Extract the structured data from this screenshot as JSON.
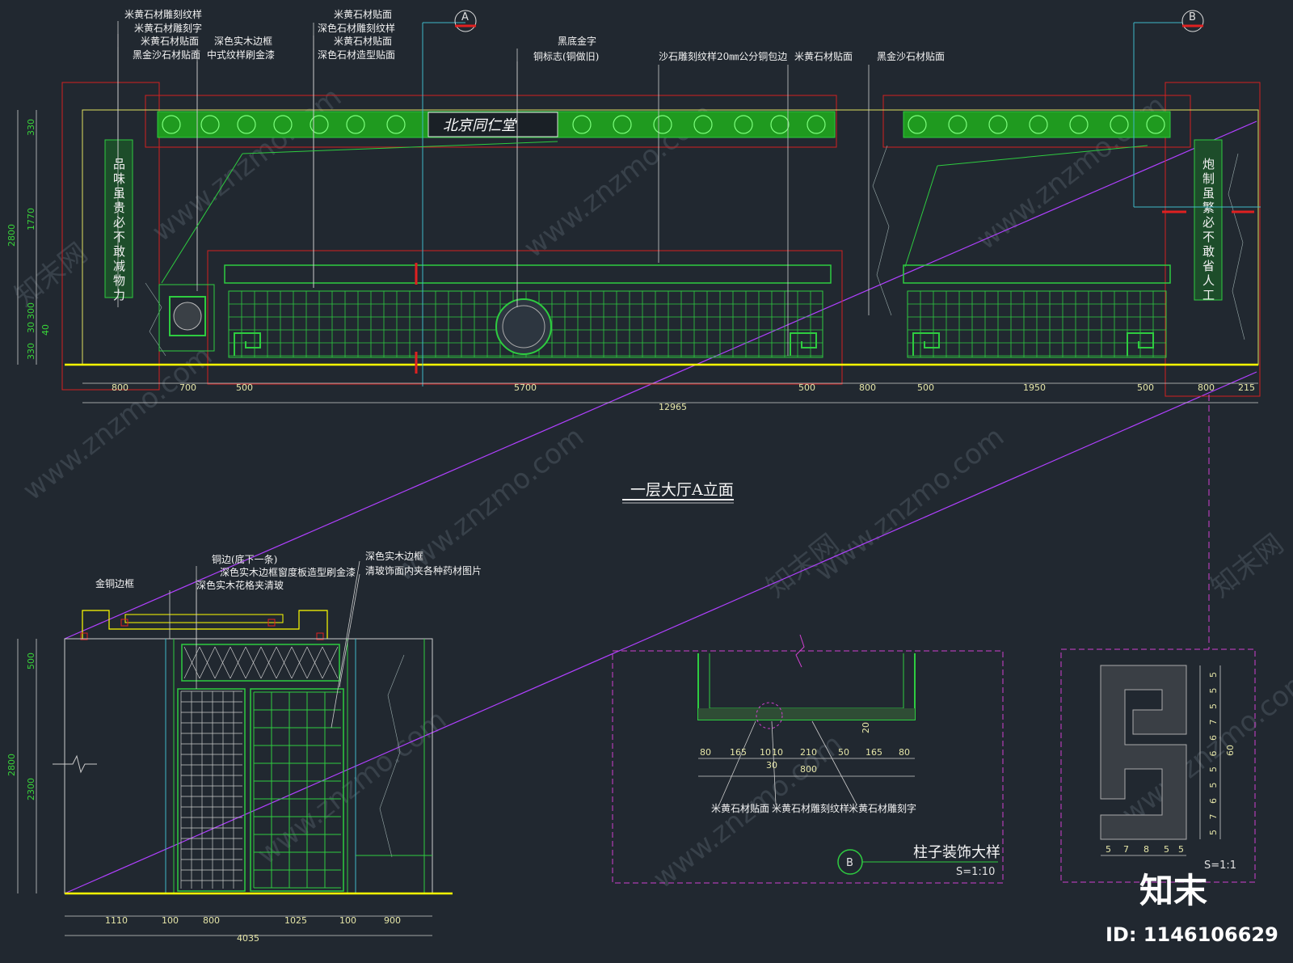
{
  "colors": {
    "background": "#212830",
    "line": "#2ecc40",
    "red": "#d42020",
    "yellow": "#ffff00",
    "magenta": "#c040ff",
    "cyan": "#3fb8c8"
  },
  "elevation_a": {
    "title": "一层大厅A立面",
    "sign_text": "北京同仁堂",
    "left_couplet": "品味虽贵必不敢减物力",
    "right_couplet": "炮制虽繁必不敢省人工",
    "section_markers": [
      "A",
      "B"
    ],
    "labels": {
      "l1": "米黄石材雕刻纹样",
      "l2": "米黄石材雕刻字",
      "l3": "米黄石材贴面",
      "l4": "黑金沙石材贴面",
      "l5": "深色实木边框",
      "l6": "中式纹样刷金漆",
      "l7": "米黄石材贴面",
      "l8": "深色石材雕刻纹样",
      "l9": "米黄石材贴面",
      "l10": "深色石材造型贴面",
      "l11": "黑底金字",
      "l12": "铜标志(铜做旧)",
      "l13": "沙石雕刻纹样20㎜公分铜包边",
      "l14": "米黄石材贴面",
      "l15": "黑金沙石材贴面"
    },
    "dims_bottom": [
      "800",
      "700",
      "500",
      "5700",
      "500",
      "800",
      "500",
      "1950",
      "500",
      "800",
      "215"
    ],
    "dim_total": "12965",
    "dims_left": [
      "330",
      "1770",
      "300",
      "30",
      "40",
      "330",
      "2800"
    ]
  },
  "section_b_elev": {
    "labels": {
      "l1": "铜边(底下一条)",
      "l2": "深色实木边框窗度板造型刷金漆",
      "l3": "深色实木花格夹清玻",
      "l4": "金铜边框",
      "l5": "深色实木边框",
      "l6": "清玻饰面内夹各种药材图片"
    },
    "dims_bottom": [
      "1110",
      "100",
      "800",
      "1025",
      "100",
      "900"
    ],
    "dim_total": "4035",
    "dims_left": [
      "500",
      "2300",
      "2800"
    ]
  },
  "column_detail": {
    "title": "柱子装饰大样",
    "scale": "S=1:10",
    "marker": "B",
    "dims": [
      "80",
      "165",
      "10",
      "10",
      "210",
      "50",
      "165",
      "80"
    ],
    "dim_30": "30",
    "dim_20": "20",
    "dim_total": "800",
    "labels": {
      "l1": "米黄石材贴面",
      "l2": "米黄石材雕刻纹样",
      "l3": "米黄石材雕刻字"
    }
  },
  "pattern_detail": {
    "scale": "S=1:1",
    "dims_bottom": [
      "5",
      "7",
      "8",
      "5",
      "5"
    ],
    "dims_right": [
      "5",
      "5",
      "5",
      "7",
      "6",
      "6",
      "5",
      "5",
      "6",
      "7",
      "5"
    ],
    "dim_total": "60"
  },
  "watermark": {
    "text": "www.znzmo.com",
    "brand": "知末网",
    "logo": "知末",
    "id": "ID: 1146106629"
  }
}
